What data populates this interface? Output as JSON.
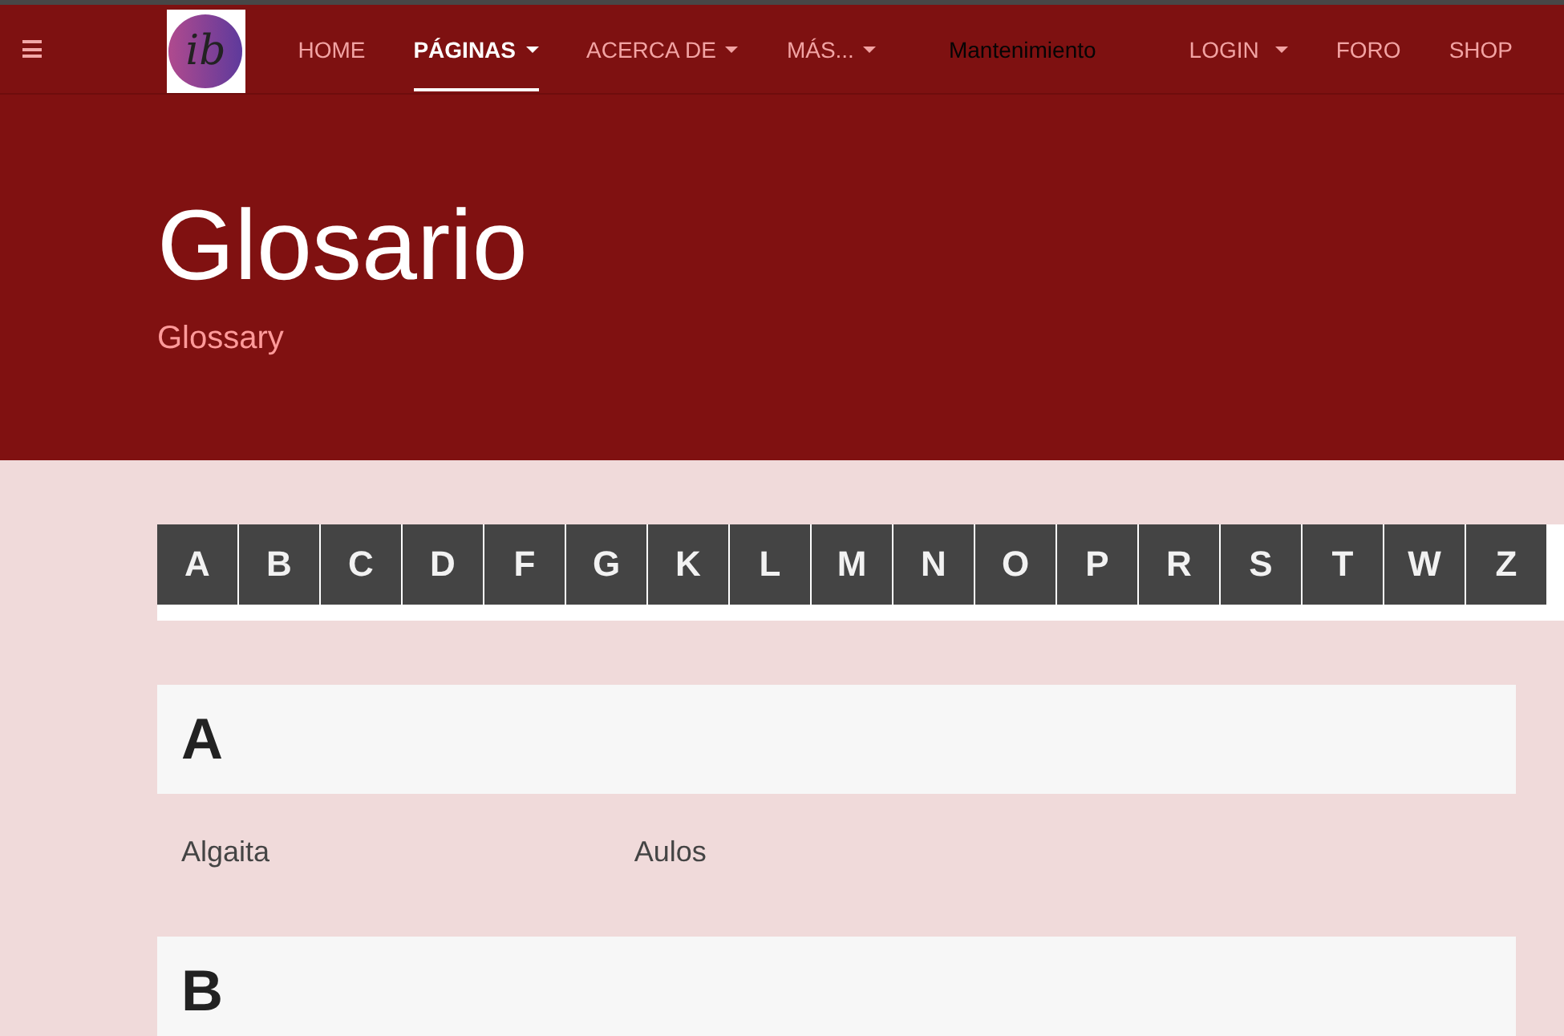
{
  "navbar": {
    "logo": {
      "monogram": "ib"
    },
    "links": [
      {
        "label": "HOME",
        "selected": false,
        "dropdown": false,
        "disabled": false
      },
      {
        "label": "PÁGINAS",
        "selected": true,
        "dropdown": true,
        "disabled": false
      },
      {
        "label": "ACERCA DE",
        "selected": false,
        "dropdown": true,
        "disabled": false
      },
      {
        "label": "MÁS...",
        "selected": false,
        "dropdown": true,
        "disabled": false
      },
      {
        "label": "Mantenimiento",
        "selected": false,
        "dropdown": false,
        "disabled": true
      }
    ],
    "right_links": [
      {
        "label": "LOGIN",
        "selected": false,
        "dropdown": true,
        "disabled": false
      },
      {
        "label": "FORO",
        "selected": false,
        "dropdown": false,
        "disabled": false
      },
      {
        "label": "SHOP",
        "selected": false,
        "dropdown": false,
        "disabled": false
      }
    ]
  },
  "header": {
    "title": "Glosario",
    "subtitle": "Glossary"
  },
  "alphabet": [
    "A",
    "B",
    "C",
    "D",
    "F",
    "G",
    "K",
    "L",
    "M",
    "N",
    "O",
    "P",
    "R",
    "S",
    "T",
    "W",
    "Z"
  ],
  "sections": [
    {
      "letter": "A",
      "terms": [
        "Algaita",
        "Aulos"
      ]
    },
    {
      "letter": "B"
    }
  ]
}
